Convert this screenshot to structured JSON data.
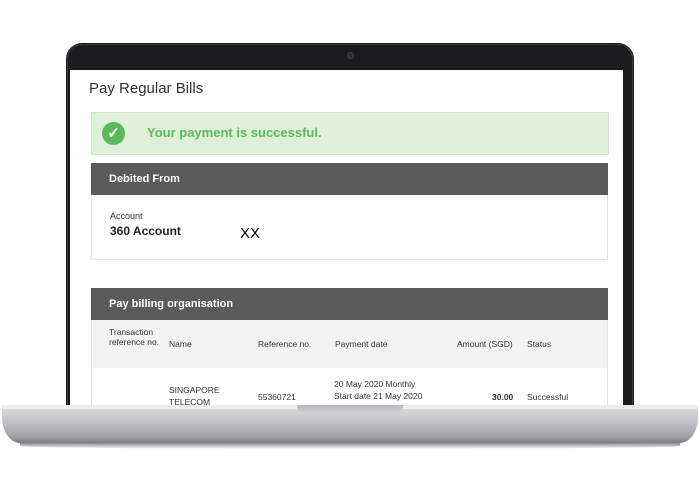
{
  "page": {
    "title": "Pay Regular Bills"
  },
  "alert": {
    "message": "Your payment is successful.",
    "icon": "check-circle-icon",
    "color": "#5cb85c"
  },
  "debited": {
    "header": "Debited From",
    "account_label": "Account",
    "account_value": "360 Account",
    "account_number_masked": "XX"
  },
  "billing": {
    "header": "Pay billing organisation",
    "columns": [
      "Transaction reference no.",
      "Name",
      "Reference no.",
      "Payment date",
      "Amount (SGD)",
      "Status"
    ],
    "rows": [
      {
        "transaction_ref": "",
        "name": "SINGAPORE TELECOM",
        "reference_no": "55360721",
        "payment_date": "20 May 2020 Monthly Start date 21 May 2020",
        "amount": "30.00",
        "status": "Successful"
      }
    ]
  }
}
